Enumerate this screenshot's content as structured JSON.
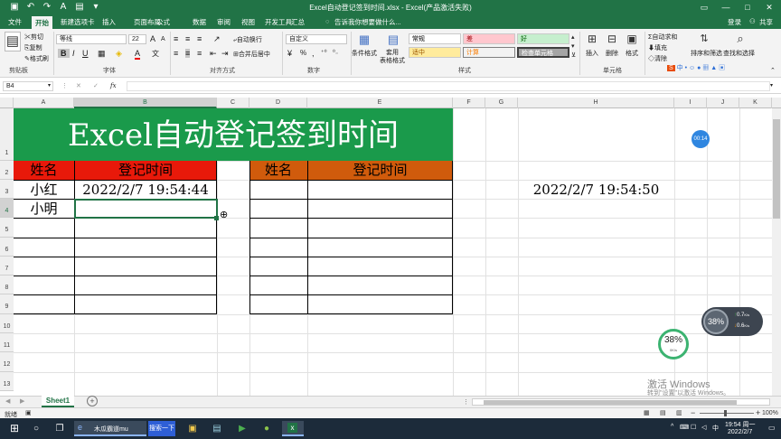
{
  "window": {
    "title": "Excel自动登记签到时间.xlsx - Excel(产品激活失败)",
    "controls": [
      "—",
      "□",
      "✕"
    ]
  },
  "menu": {
    "items": [
      "文件",
      "开始",
      "新建选项卡",
      "插入",
      "页面布局",
      "公式",
      "数据",
      "审阅",
      "视图",
      "开发工具",
      "汇总"
    ],
    "tellme": "告诉我你想要做什么...",
    "login": "登录",
    "share": "共享"
  },
  "ribbon": {
    "clipboard": {
      "cut": "剪切",
      "copy": "复制",
      "painter": "格式刷",
      "label": "剪贴板"
    },
    "font": {
      "name": "等线",
      "size": "22",
      "bold": "B",
      "italic": "I",
      "underline": "U",
      "label": "字体",
      "grow": "A",
      "shrink": "A",
      "color_label": "A",
      "wen": "文"
    },
    "align": {
      "wrap": "自动换行",
      "merge": "合并后居中",
      "label": "对齐方式"
    },
    "number": {
      "format": "自定义",
      "percent": "%",
      "comma": ",",
      "label": "数字"
    },
    "styles": {
      "cond_format": "条件格式",
      "table_format": "套用\n表格格式",
      "label": "样式",
      "cells": [
        {
          "text": "常规",
          "bg": "#ffffff",
          "fg": "#000000"
        },
        {
          "text": "差",
          "bg": "#ffc7ce",
          "fg": "#9c0006"
        },
        {
          "text": "好",
          "bg": "#c6efce",
          "fg": "#006100"
        },
        {
          "text": "适中",
          "bg": "#ffeb9c",
          "fg": "#9c5700"
        },
        {
          "text": "计算",
          "bg": "#f2f2f2",
          "fg": "#fa7d00"
        },
        {
          "text": "检查单元格",
          "bg": "#a5a5a5",
          "fg": "#ffffff"
        }
      ]
    },
    "cells": {
      "insert": "插入",
      "delete": "删除",
      "format": "格式",
      "label": "单元格"
    },
    "edit": {
      "autosum": "自动求和",
      "fill": "填充",
      "clear": "清除",
      "sort": "排序和筛选",
      "find": "查找和选择"
    }
  },
  "formula": {
    "namebox": "B4",
    "fx": "fx",
    "cancel": "✕",
    "enter": "✓",
    "value": ""
  },
  "columns": [
    "A",
    "B",
    "C",
    "D",
    "E",
    "F",
    "G",
    "H",
    "I",
    "J",
    "K"
  ],
  "rows": [
    "1",
    "2",
    "3",
    "4",
    "5",
    "6",
    "7",
    "8",
    "9",
    "10",
    "11",
    "12",
    "13"
  ],
  "sheet": {
    "banner": "Excel自动登记签到时间",
    "banner_bg": "#1a9a4b",
    "t1_headers": [
      "姓名",
      "登记时间"
    ],
    "t1_header_bg": "#e8190a",
    "t2_headers": [
      "姓名",
      "登记时间"
    ],
    "t2_header_bg": "#d05b0c",
    "names": [
      "小红",
      "小明"
    ],
    "time1": "2022/2/7  19:54:44",
    "time_h": "2022/2/7  19:54:50"
  },
  "overlay": {
    "badge": "00:14",
    "net_pct": "38%",
    "net_up": "0.7",
    "net_up_unit": "K/s",
    "net_down": "0.6",
    "net_down_unit": "K/s",
    "net_pct2": "38%",
    "net_small": "0K/s"
  },
  "watermark": {
    "line1": "激活 Windows",
    "line2": "转到\"设置\"以激活 Windows。"
  },
  "tabs": {
    "sheet1": "Sheet1",
    "add": "+"
  },
  "status": {
    "ready": "就绪",
    "zoom": "100%",
    "minus": "−",
    "plus": "+"
  },
  "taskbar": {
    "app1": "木瓜霸道mu",
    "search": "搜索一下",
    "time": "19:54 周一",
    "date": "2022/2/7",
    "lang": "中"
  }
}
